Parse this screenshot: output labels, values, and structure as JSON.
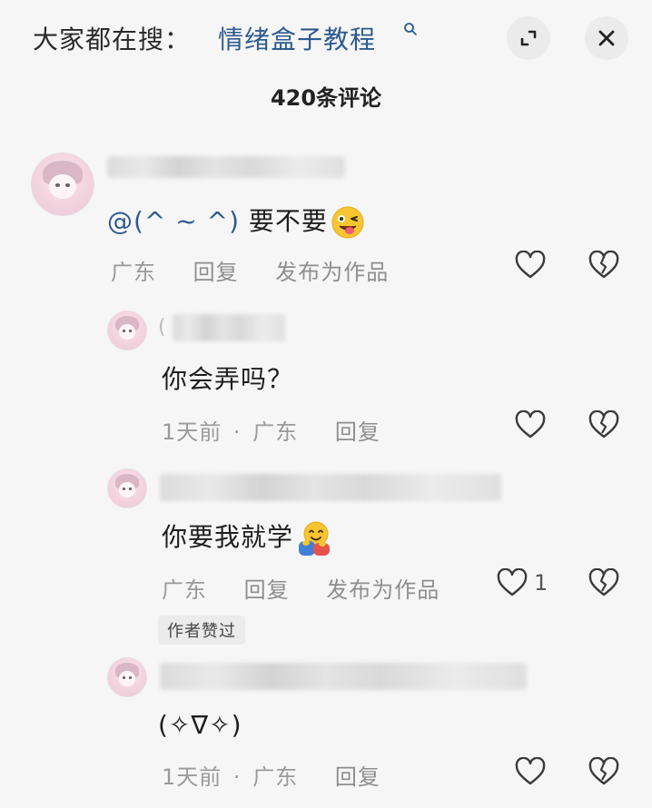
{
  "header": {
    "search_prefix": "大家都在搜：",
    "search_term": "情绪盒子教程",
    "comment_count": "420条评论"
  },
  "icons": {
    "search": "search-icon",
    "expand": "expand-icon",
    "close": "close-icon",
    "like": "heart-outline-icon",
    "dislike": "broken-heart-icon"
  },
  "colors": {
    "link": "#2d5b8f",
    "meta": "#9a9a9a",
    "text": "#1e1e1e",
    "background": "#f6f6f6"
  },
  "comments": [
    {
      "mention": "@(^ ~ ^)",
      "text": " 要不要",
      "emoji": "winking-tongue-emoji",
      "location": "广东",
      "reply_label": "回复",
      "publish_label": "发布为作品"
    },
    {
      "text": "你会弄吗？",
      "time": "1天前",
      "dot": "·",
      "location": "广东",
      "reply_label": "回复"
    },
    {
      "text": "你要我就学",
      "emoji": "hugging-emoji",
      "location": "广东",
      "reply_label": "回复",
      "publish_label": "发布为作品",
      "like_count": "1",
      "author_liked": "作者赞过"
    },
    {
      "text": "(✧∇✧)",
      "time": "1天前",
      "dot": "·",
      "location": "广东",
      "reply_label": "回复"
    }
  ]
}
